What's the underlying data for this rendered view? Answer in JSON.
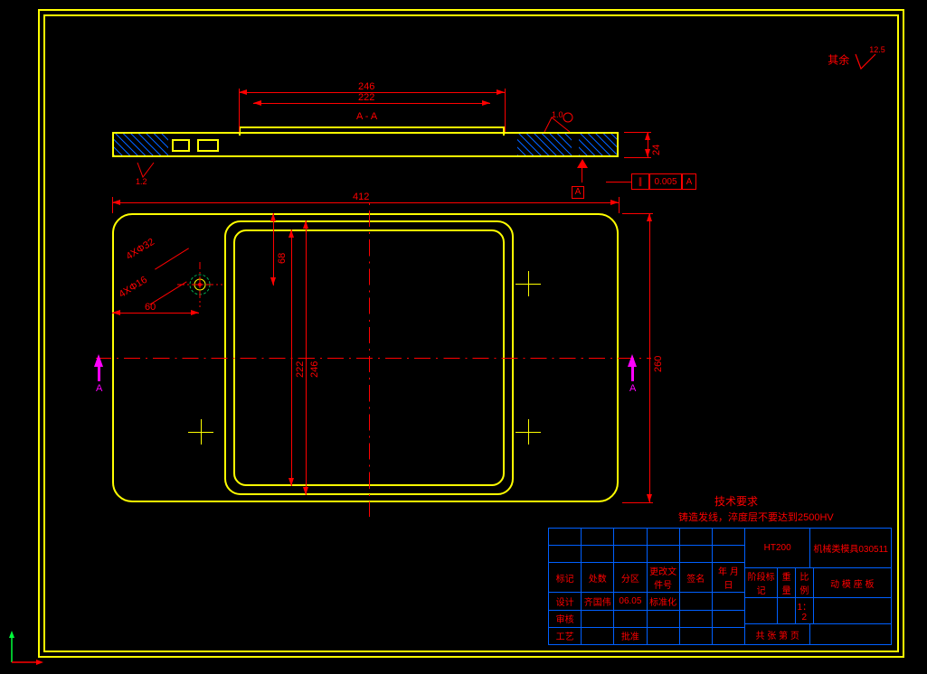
{
  "corner_note": {
    "text": "其余",
    "ra": "12.5"
  },
  "dimensions": {
    "top_outer": "246",
    "top_inner": "222",
    "sect_label": "A - A",
    "height_24": "24",
    "width_412": "412",
    "hole1": "4XΦ32",
    "hole2": "4XΦ16",
    "dim60": "60",
    "dim68": "68",
    "v222": "222",
    "v246": "246",
    "v260": "260",
    "sf_val_small": "1.2",
    "sf_val_top": "1.0"
  },
  "gtol": {
    "sym": "∥",
    "val": "0.005",
    "datum": "A"
  },
  "datum_label": "A",
  "section_mark": "A",
  "tech_req": {
    "title": "技术要求",
    "body": "铸造发线，淬度层不要达到2500HV"
  },
  "title_block": {
    "headers": [
      "标记",
      "处数",
      "分区",
      "更改文件号",
      "签名",
      "年 月 日"
    ],
    "row2": [
      "设计",
      "齐国伟",
      "06.05",
      "标准化",
      "",
      ""
    ],
    "row3": [
      "审核",
      "",
      "",
      "",
      "",
      ""
    ],
    "row4": [
      "工艺",
      "",
      "批准",
      "",
      "",
      ""
    ],
    "material": "HT200",
    "drawing_no": "机械类模具030511",
    "part_name": "动 模 座 板",
    "stage_h": [
      "阶段标记",
      "重量",
      "比例"
    ],
    "scale": "1：2",
    "sheet": "共 张   第 页"
  }
}
